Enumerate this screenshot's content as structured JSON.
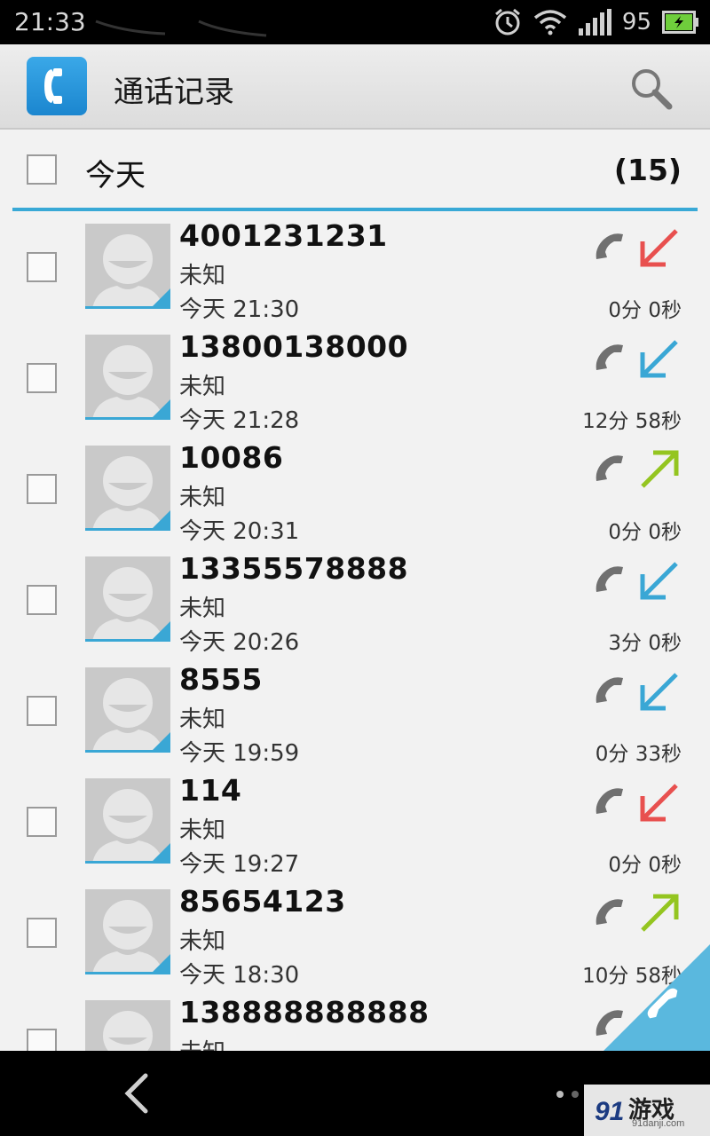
{
  "status_bar": {
    "time": "21:33",
    "battery_level": "95",
    "icons": [
      "alarm-icon",
      "wifi-icon",
      "signal-icon",
      "battery-charging-icon"
    ]
  },
  "action_bar": {
    "app_icon": "phone-app-icon",
    "title": "通话记录",
    "search_icon": "search-icon"
  },
  "section": {
    "title": "今天",
    "count": "(15)"
  },
  "colors": {
    "accent": "#39a9d6",
    "missed": "#e8504f",
    "incoming": "#3aa7d5",
    "outgoing": "#94c520"
  },
  "calls": [
    {
      "number": "4001231231",
      "name": "未知",
      "time": "今天 21:30",
      "duration": "0分 0秒",
      "type": "missed"
    },
    {
      "number": "13800138000",
      "name": "未知",
      "time": "今天 21:28",
      "duration": "12分 58秒",
      "type": "incoming"
    },
    {
      "number": "10086",
      "name": "未知",
      "time": "今天 20:31",
      "duration": "0分 0秒",
      "type": "outgoing"
    },
    {
      "number": "13355578888",
      "name": "未知",
      "time": "今天 20:26",
      "duration": "3分 0秒",
      "type": "incoming"
    },
    {
      "number": "8555",
      "name": "未知",
      "time": "今天 19:59",
      "duration": "0分 33秒",
      "type": "incoming"
    },
    {
      "number": "114",
      "name": "未知",
      "time": "今天 19:27",
      "duration": "0分 0秒",
      "type": "missed"
    },
    {
      "number": "85654123",
      "name": "未知",
      "time": "今天 18:30",
      "duration": "10分 58秒",
      "type": "outgoing"
    },
    {
      "number": "138888888888",
      "name": "未知",
      "time": "",
      "duration": "",
      "type": "incoming"
    }
  ],
  "nav_bar": {
    "back_icon": "back-arrow-icon"
  },
  "watermark": {
    "text": "游戏",
    "sub": "91danji.com",
    "mark": "91"
  }
}
